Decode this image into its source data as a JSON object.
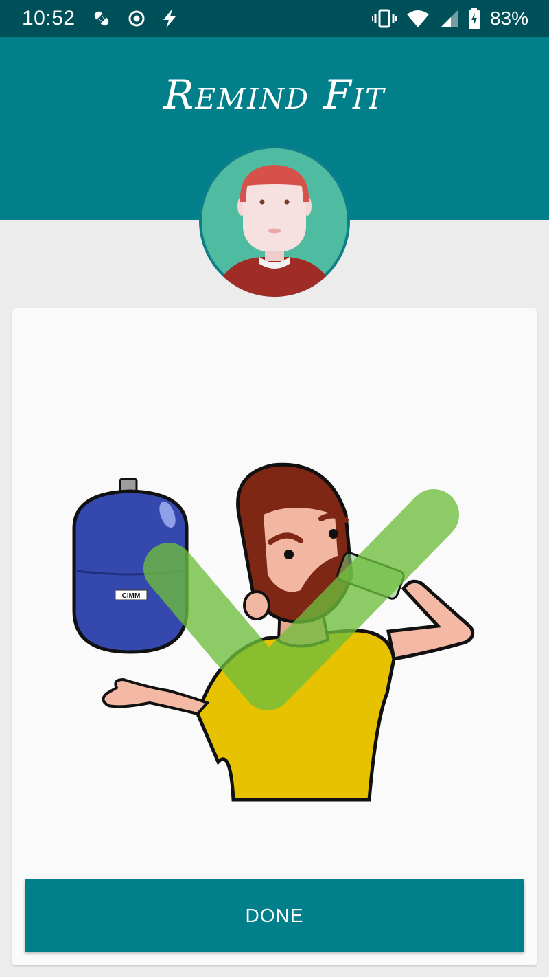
{
  "status_bar": {
    "time": "10:52",
    "battery": "83%",
    "icons": [
      "bandage-icon",
      "record-icon",
      "flash-icon",
      "vibrate-icon",
      "wifi-icon",
      "signal-icon",
      "battery-charging-icon"
    ]
  },
  "app": {
    "title": "Remind Fit",
    "accent_color": "#017f8b",
    "status_color": "#00505a"
  },
  "card": {
    "image_label": "CIMM",
    "done_label": "DONE"
  }
}
